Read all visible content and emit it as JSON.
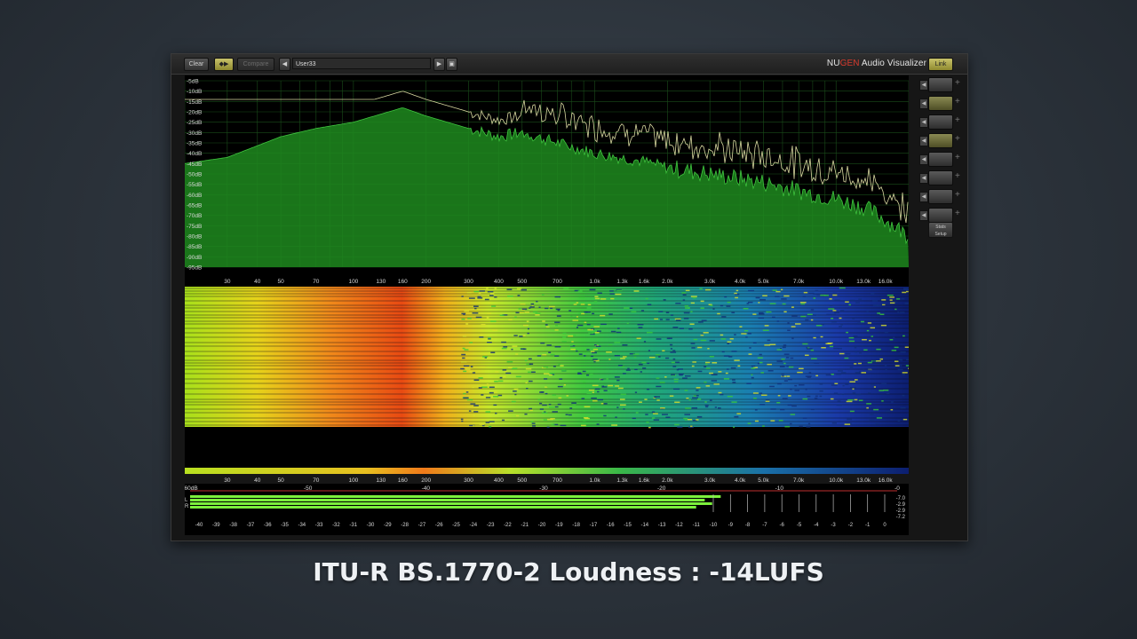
{
  "window": {
    "brand_prefix": "NU",
    "brand_gen": "GEN",
    "brand_suffix": " Audio Visualizer"
  },
  "toolbar": {
    "clear_label": "Clear",
    "swap_label": "◆▶",
    "compare_label": "Compare",
    "prev_label": "◀",
    "preset_name": "User33",
    "next_label": "▶",
    "save_label": "▣",
    "link_label": "Link"
  },
  "spectrum": {
    "db_labels": [
      "-5dB",
      "-10dB",
      "-15dB",
      "-20dB",
      "-25dB",
      "-30dB",
      "-35dB",
      "-40dB",
      "-45dB",
      "-50dB",
      "-55dB",
      "-60dB",
      "-65dB",
      "-70dB",
      "-75dB",
      "-80dB",
      "-85dB",
      "-90dB",
      "-95dB"
    ],
    "db_range": [
      -5,
      -95
    ],
    "freq_labels": [
      "30",
      "40",
      "50",
      "70",
      "100",
      "130",
      "160",
      "200",
      "300",
      "400",
      "500",
      "700",
      "1.0k",
      "1.3k",
      "1.6k",
      "2.0k",
      "3.0k",
      "4.0k",
      "5.0k",
      "7.0k",
      "10.0k",
      "13.0k",
      "16.0k"
    ],
    "freq_values": [
      30,
      40,
      50,
      70,
      100,
      130,
      160,
      200,
      300,
      400,
      500,
      700,
      1000,
      1300,
      1600,
      2000,
      3000,
      4000,
      5000,
      7000,
      10000,
      13000,
      16000
    ],
    "freq_range": [
      20,
      20000
    ],
    "fill_color": "#1f8a1f",
    "peak_color": "#d8d8a0",
    "grid_color": "#1a4d1a"
  },
  "meters": {
    "scale_top_labels": [
      "-60dB",
      "-50",
      "-40",
      "-30",
      "-20",
      "-10",
      "-0"
    ],
    "scale_top_values": [
      -60,
      -50,
      -40,
      -30,
      -20,
      -10,
      0
    ],
    "scale_bottom_labels": [
      "-40",
      "-39",
      "-38",
      "-37",
      "-36",
      "-35",
      "-34",
      "-33",
      "-32",
      "-31",
      "-30",
      "-29",
      "-28",
      "-27",
      "-26",
      "-25",
      "-24",
      "-23",
      "-22",
      "-21",
      "-20",
      "-19",
      "-18",
      "-17",
      "-16",
      "-15",
      "-14",
      "-13",
      "-12",
      "-11",
      "-10",
      "-9",
      "-8",
      "-7",
      "-6",
      "-5",
      "-4",
      "-3",
      "-2",
      "-1",
      "0"
    ],
    "channel_labels": [
      "L",
      "R"
    ],
    "level_left_db": -10.5,
    "level_right_db": -11,
    "readouts": [
      "-7.0",
      "-2.9",
      "-2.9",
      "-7.2"
    ],
    "meter_color": "#7cf03c"
  },
  "sidebar": {
    "stats_line1": "Stats",
    "stats_line2": "Setup"
  },
  "caption": "ITU-R BS.1770-2 Loudness : -14LUFS"
}
